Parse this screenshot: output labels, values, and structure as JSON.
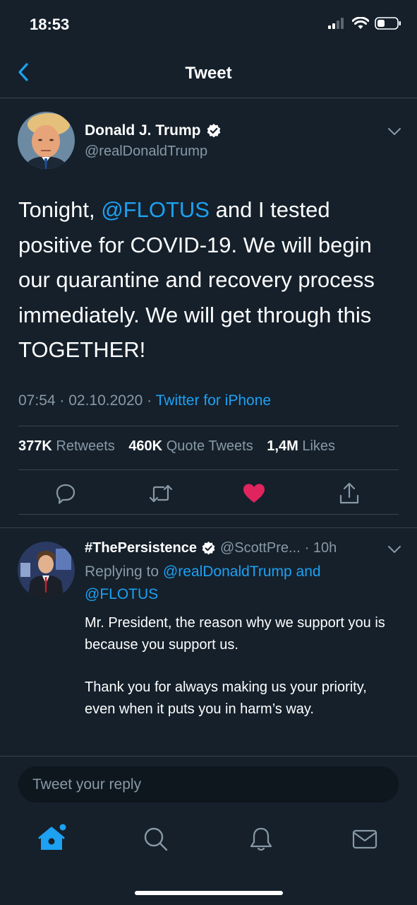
{
  "status_bar": {
    "time": "18:53"
  },
  "header": {
    "title": "Tweet"
  },
  "tweet": {
    "author_name": "Donald J. Trump",
    "author_handle": "@realDonaldTrump",
    "text_before": "Tonight, ",
    "mention": "@FLOTUS",
    "text_after": " and I tested positive for COVID-19. We will begin our quarantine and recovery process immediately. We will get through this TOGETHER!",
    "time": "07:54",
    "separator": " · ",
    "date": "02.10.2020",
    "source": "Twitter for iPhone",
    "retweets_count": "377K",
    "retweets_label": "Retweets",
    "quotes_count": "460K",
    "quotes_label": "Quote Tweets",
    "likes_count": "1,4M",
    "likes_label": "Likes"
  },
  "reply": {
    "author_name": "#ThePersistence",
    "author_handle": "@ScottPre...",
    "age": "· 10h",
    "replying_prefix": "Replying to ",
    "replying_to": "@realDonaldTrump and @FLOTUS",
    "paragraph1": "Mr. President, the reason why we support you is because you support us.",
    "paragraph2": "Thank you for always making us your priority, even when it puts you in harm’s way."
  },
  "compose": {
    "placeholder": "Tweet your reply"
  },
  "colors": {
    "background": "#15202b",
    "accent": "#1da1f2",
    "like": "#e0245e",
    "muted": "#8899a6"
  },
  "icons": [
    "back-chevron-icon",
    "verified-badge-icon",
    "chevron-down-icon",
    "reply-icon",
    "retweet-icon",
    "like-heart-icon",
    "share-icon",
    "home-icon",
    "search-icon",
    "notifications-bell-icon",
    "messages-envelope-icon"
  ]
}
